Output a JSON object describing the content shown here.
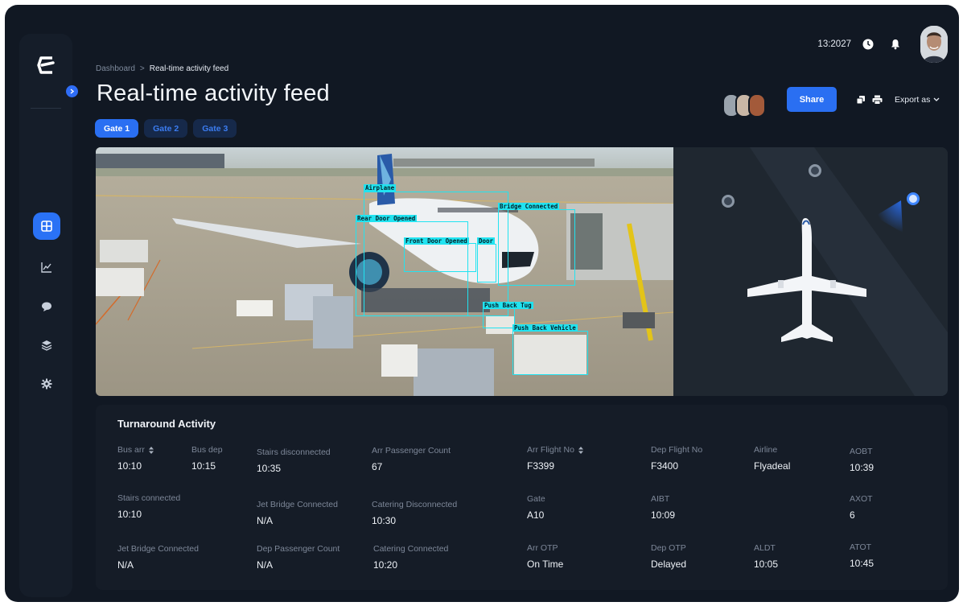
{
  "header": {
    "breadcrumb": {
      "root": "Dashboard",
      "separator": ">",
      "current": "Real-time activity feed"
    },
    "title": "Real-time activity feed",
    "time": "13:2027",
    "share_label": "Share",
    "export_label": "Export as"
  },
  "tabs": [
    {
      "label": "Gate 1",
      "active": true
    },
    {
      "label": "Gate 2",
      "active": false
    },
    {
      "label": "Gate 3",
      "active": false
    }
  ],
  "sidebar": {
    "items": [
      {
        "icon": "dashboard-grid-icon",
        "active": true
      },
      {
        "icon": "chart-icon",
        "active": false
      },
      {
        "icon": "chat-icon",
        "active": false
      },
      {
        "icon": "layers-icon",
        "active": false
      },
      {
        "icon": "gear-icon",
        "active": false
      }
    ]
  },
  "detections": {
    "airplane": "Airplane",
    "rear_door": "Rear Door Opened",
    "bridge": "Bridge Connected",
    "front_door": "Front Door Opened",
    "door": "Door",
    "push_back_tug": "Push Back Tug",
    "push_back_vehicle": "Push Back Vehicle"
  },
  "activity": {
    "title": "Turnaround Activity",
    "fields": {
      "bus_arr": {
        "label": "Bus arr",
        "value": "10:10"
      },
      "bus_dep": {
        "label": "Bus dep",
        "value": "10:15"
      },
      "stairs_disconnected": {
        "label": "Stairs disconnected",
        "value": "10:35"
      },
      "arr_passenger_count": {
        "label": "Arr Passenger Count",
        "value": "67"
      },
      "arr_flight_no": {
        "label": "Arr Flight No",
        "value": "F3399"
      },
      "dep_flight_no": {
        "label": "Dep Flight No",
        "value": "F3400"
      },
      "airline": {
        "label": "Airline",
        "value": "Flyadeal"
      },
      "aobt": {
        "label": "AOBT",
        "value": "10:39"
      },
      "stairs_connected": {
        "label": "Stairs connected",
        "value": "10:10"
      },
      "jet_bridge_connected_1": {
        "label": "Jet Bridge Connected",
        "value": "N/A"
      },
      "catering_disconnected": {
        "label": "Catering Disconnected",
        "value": "10:30"
      },
      "gate": {
        "label": "Gate",
        "value": "A10"
      },
      "aibt": {
        "label": "AIBT",
        "value": "10:09"
      },
      "axot": {
        "label": "AXOT",
        "value": "6"
      },
      "jet_bridge_connected_2": {
        "label": "Jet Bridge Connected",
        "value": "N/A"
      },
      "dep_passenger_count": {
        "label": "Dep Passenger Count",
        "value": "N/A"
      },
      "catering_connected": {
        "label": "Catering Connected",
        "value": "10:20"
      },
      "arr_otp": {
        "label": "Arr OTP",
        "value": "On Time"
      },
      "dep_otp": {
        "label": "Dep OTP",
        "value": "Delayed"
      },
      "aldt": {
        "label": "ALDT",
        "value": "10:05"
      },
      "atot": {
        "label": "ATOT",
        "value": "10:45"
      }
    }
  },
  "colors": {
    "accent": "#2a6ff2",
    "background": "#111823",
    "panel": "#151c27",
    "detection": "#21e3f0"
  }
}
